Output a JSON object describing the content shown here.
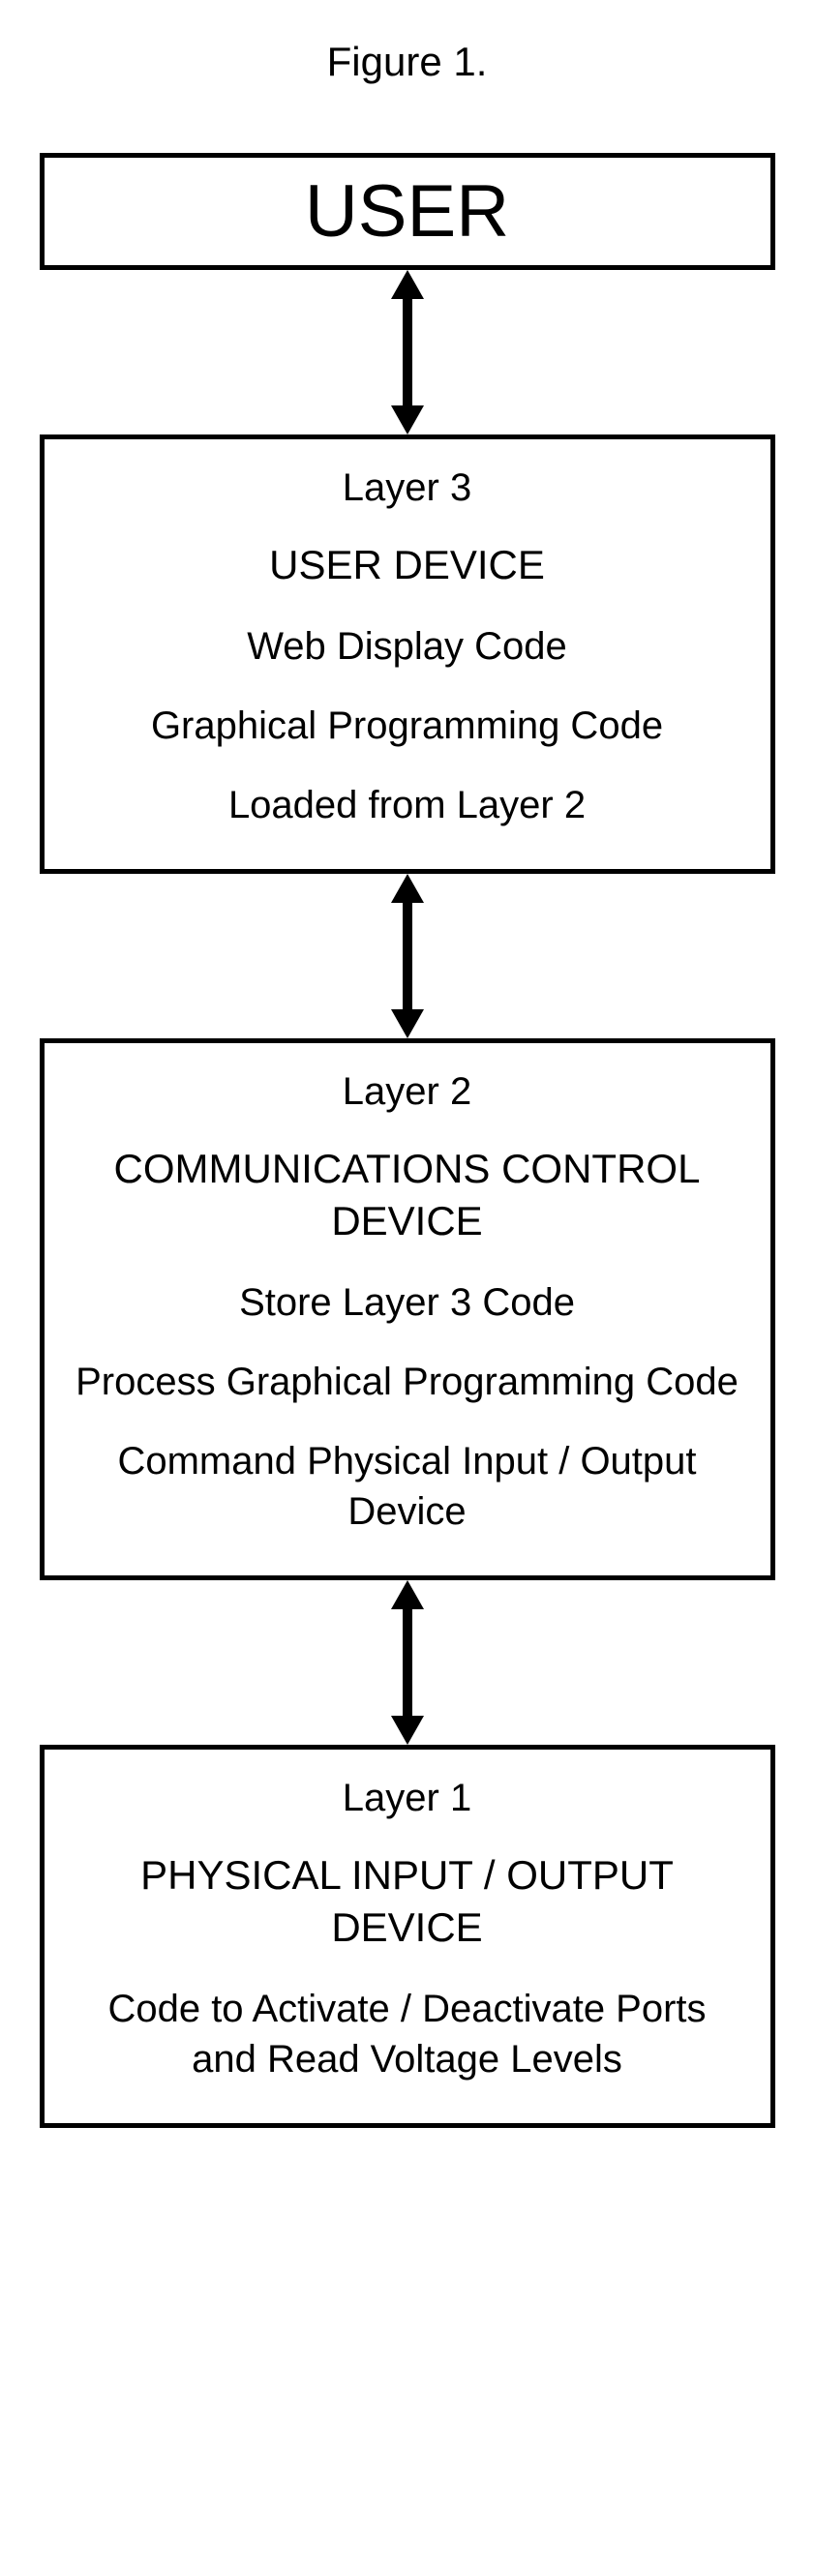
{
  "figure_title": "Figure 1.",
  "user_box": {
    "label": "USER"
  },
  "layer3": {
    "header": "Layer 3",
    "title": "USER DEVICE",
    "lines": [
      "Web Display Code",
      "Graphical Programming Code",
      "Loaded from Layer 2"
    ]
  },
  "layer2": {
    "header": "Layer 2",
    "title": "COMMUNICATIONS CONTROL DEVICE",
    "lines": [
      "Store Layer 3 Code",
      "Process Graphical Programming Code",
      "Command Physical Input / Output Device"
    ]
  },
  "layer1": {
    "header": "Layer 1",
    "title": "PHYSICAL INPUT / OUTPUT DEVICE",
    "lines": [
      "Code to Activate / Deactivate Ports and Read Voltage Levels"
    ]
  }
}
